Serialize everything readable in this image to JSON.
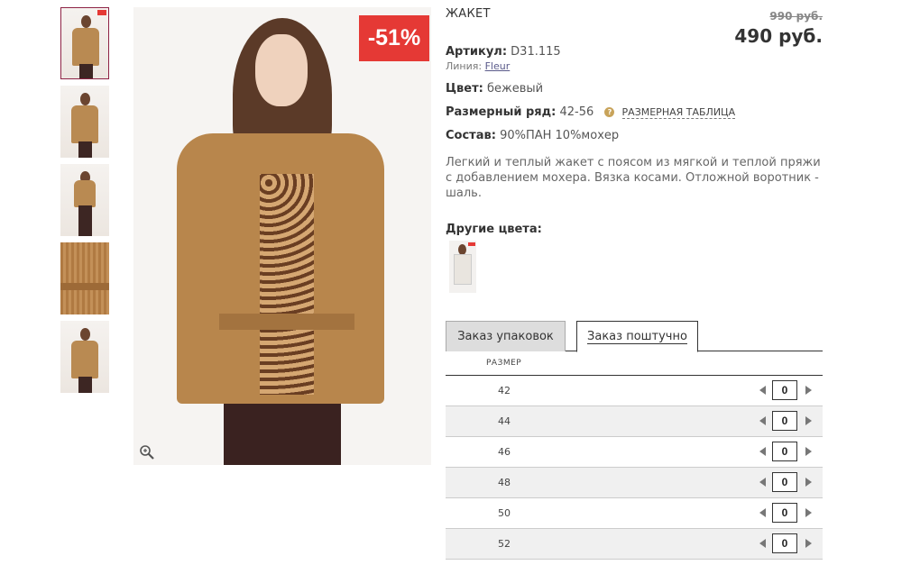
{
  "product": {
    "title": "ЖАКЕТ",
    "old_price": "990 руб.",
    "price": "490 руб.",
    "discount_badge": "-51%",
    "article_label": "Артикул:",
    "article_value": "D31.115",
    "line_label": "Линия:",
    "line_value": "Fleur",
    "color_label": "Цвет:",
    "color_value": "бежевый",
    "size_range_label": "Размерный ряд:",
    "size_range_value": "42-56",
    "size_table_link": "РАЗМЕРНАЯ ТАБЛИЦА",
    "composition_label": "Состав:",
    "composition_value": "90%ПАН 10%мохер",
    "description": "Легкий и теплый жакет с поясом из мягкой и теплой пряжи с добавлением мохера. Вязка косами. Отложной воротник - шаль.",
    "other_colors_label": "Другие цвета:"
  },
  "tabs": [
    {
      "label": "Заказ упаковок"
    },
    {
      "label": "Заказ поштучно"
    }
  ],
  "size_table": {
    "header": "РАЗМЕР",
    "rows": [
      {
        "size": "42",
        "qty": "0"
      },
      {
        "size": "44",
        "qty": "0"
      },
      {
        "size": "46",
        "qty": "0"
      },
      {
        "size": "48",
        "qty": "0"
      },
      {
        "size": "50",
        "qty": "0"
      },
      {
        "size": "52",
        "qty": "0"
      }
    ]
  },
  "colors": {
    "discount": "#e53935",
    "accent": "#8e2345",
    "jacket": "#b8864c"
  },
  "icons": [
    "zoom-icon",
    "help-icon",
    "arrow-left-icon",
    "arrow-right-icon"
  ]
}
